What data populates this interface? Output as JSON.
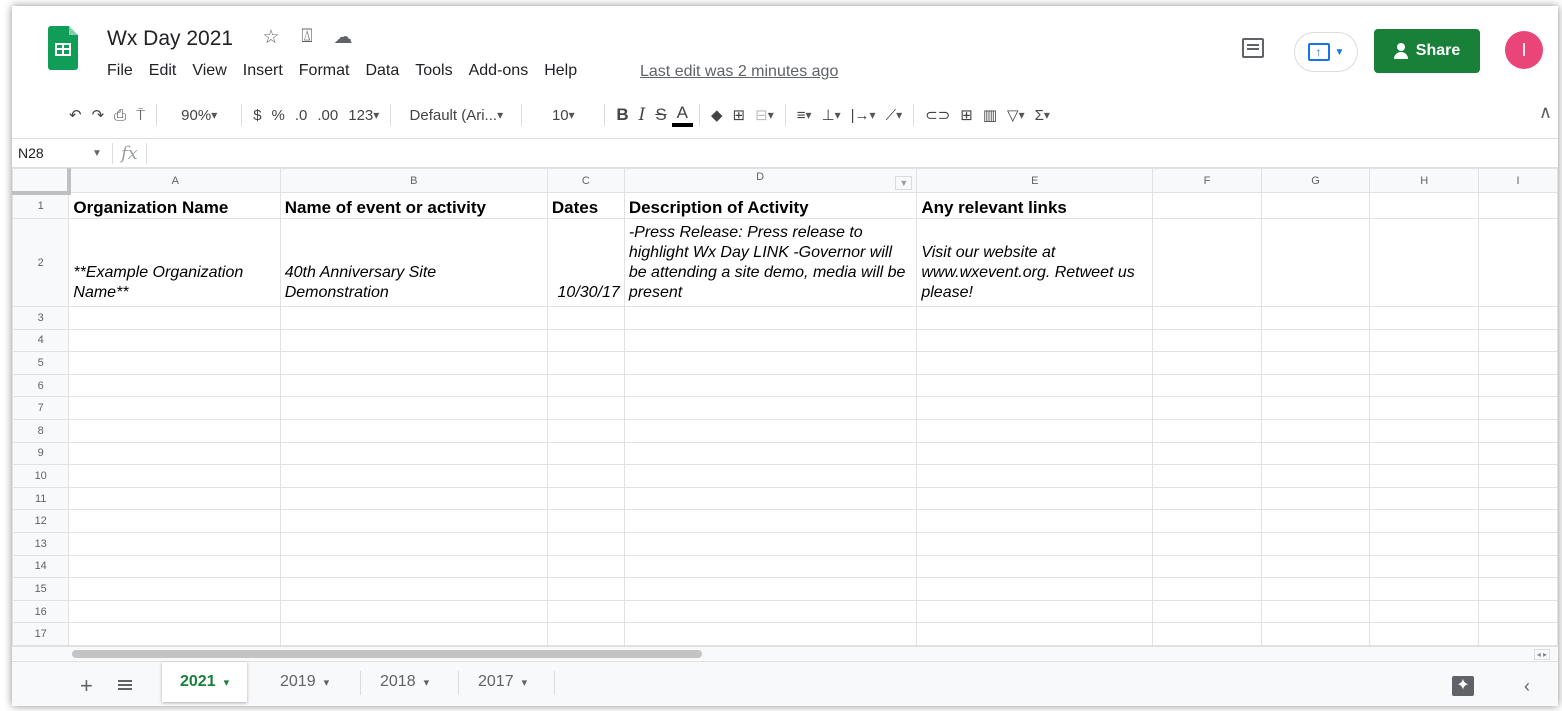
{
  "app": {
    "title": "Wx Day 2021",
    "last_edit": "Last edit was 2 minutes ago",
    "share_label": "Share",
    "avatar_initial": "I",
    "accent_color": "#188038"
  },
  "menu": [
    "File",
    "Edit",
    "View",
    "Insert",
    "Format",
    "Data",
    "Tools",
    "Add-ons",
    "Help"
  ],
  "toolbar": {
    "zoom": "90%",
    "currency": "$",
    "percent": "%",
    "decrease_decimal": ".0",
    "increase_decimal": ".00",
    "more_formats": "123",
    "font": "Default (Ari...",
    "font_size": "10",
    "bold": "B",
    "italic": "I",
    "strike": "S",
    "text_color": "A",
    "functions": "Σ"
  },
  "formula_bar": {
    "cell_ref": "N28",
    "fx": "fx",
    "value": ""
  },
  "grid": {
    "columns": [
      "A",
      "B",
      "C",
      "D",
      "E",
      "F",
      "G",
      "H",
      "I"
    ],
    "headers": [
      "Organization Name",
      "Name of event or activity",
      "Dates",
      "Description of Activity",
      "Any relevant links"
    ],
    "example_row": {
      "org": "**Example Organization Name**",
      "event": "40th Anniversary Site Demonstration",
      "dates": "10/30/17",
      "description": "-Press Release: Press release to highlight Wx Day LINK -Governor will be attending a site demo, media will be present",
      "links": "Visit our website at www.wxevent.org. Retweet us please!"
    },
    "row_numbers": [
      "1",
      "2",
      "3",
      "4",
      "5",
      "6",
      "7",
      "8",
      "9",
      "10",
      "11",
      "12",
      "13",
      "14",
      "15",
      "16",
      "17"
    ]
  },
  "tabs": [
    {
      "label": "2021",
      "active": true
    },
    {
      "label": "2019",
      "active": false
    },
    {
      "label": "2018",
      "active": false
    },
    {
      "label": "2017",
      "active": false
    }
  ],
  "icons": {
    "star": "☆",
    "move_to_drive": "⍍",
    "cloud": "☁",
    "undo": "↶",
    "redo": "↷",
    "print": "⎙",
    "paint_format": "⍑",
    "fill_color": "◆",
    "borders": "⊞",
    "merge": "⊟",
    "align": "≡",
    "valign": "⊥",
    "wrap": "|→",
    "rotate": "⟋",
    "link": "⊂⊃",
    "comment": "⊞",
    "chart": "▥",
    "filter": "▽",
    "collapse": "∧",
    "add": "+",
    "side": "‹"
  }
}
